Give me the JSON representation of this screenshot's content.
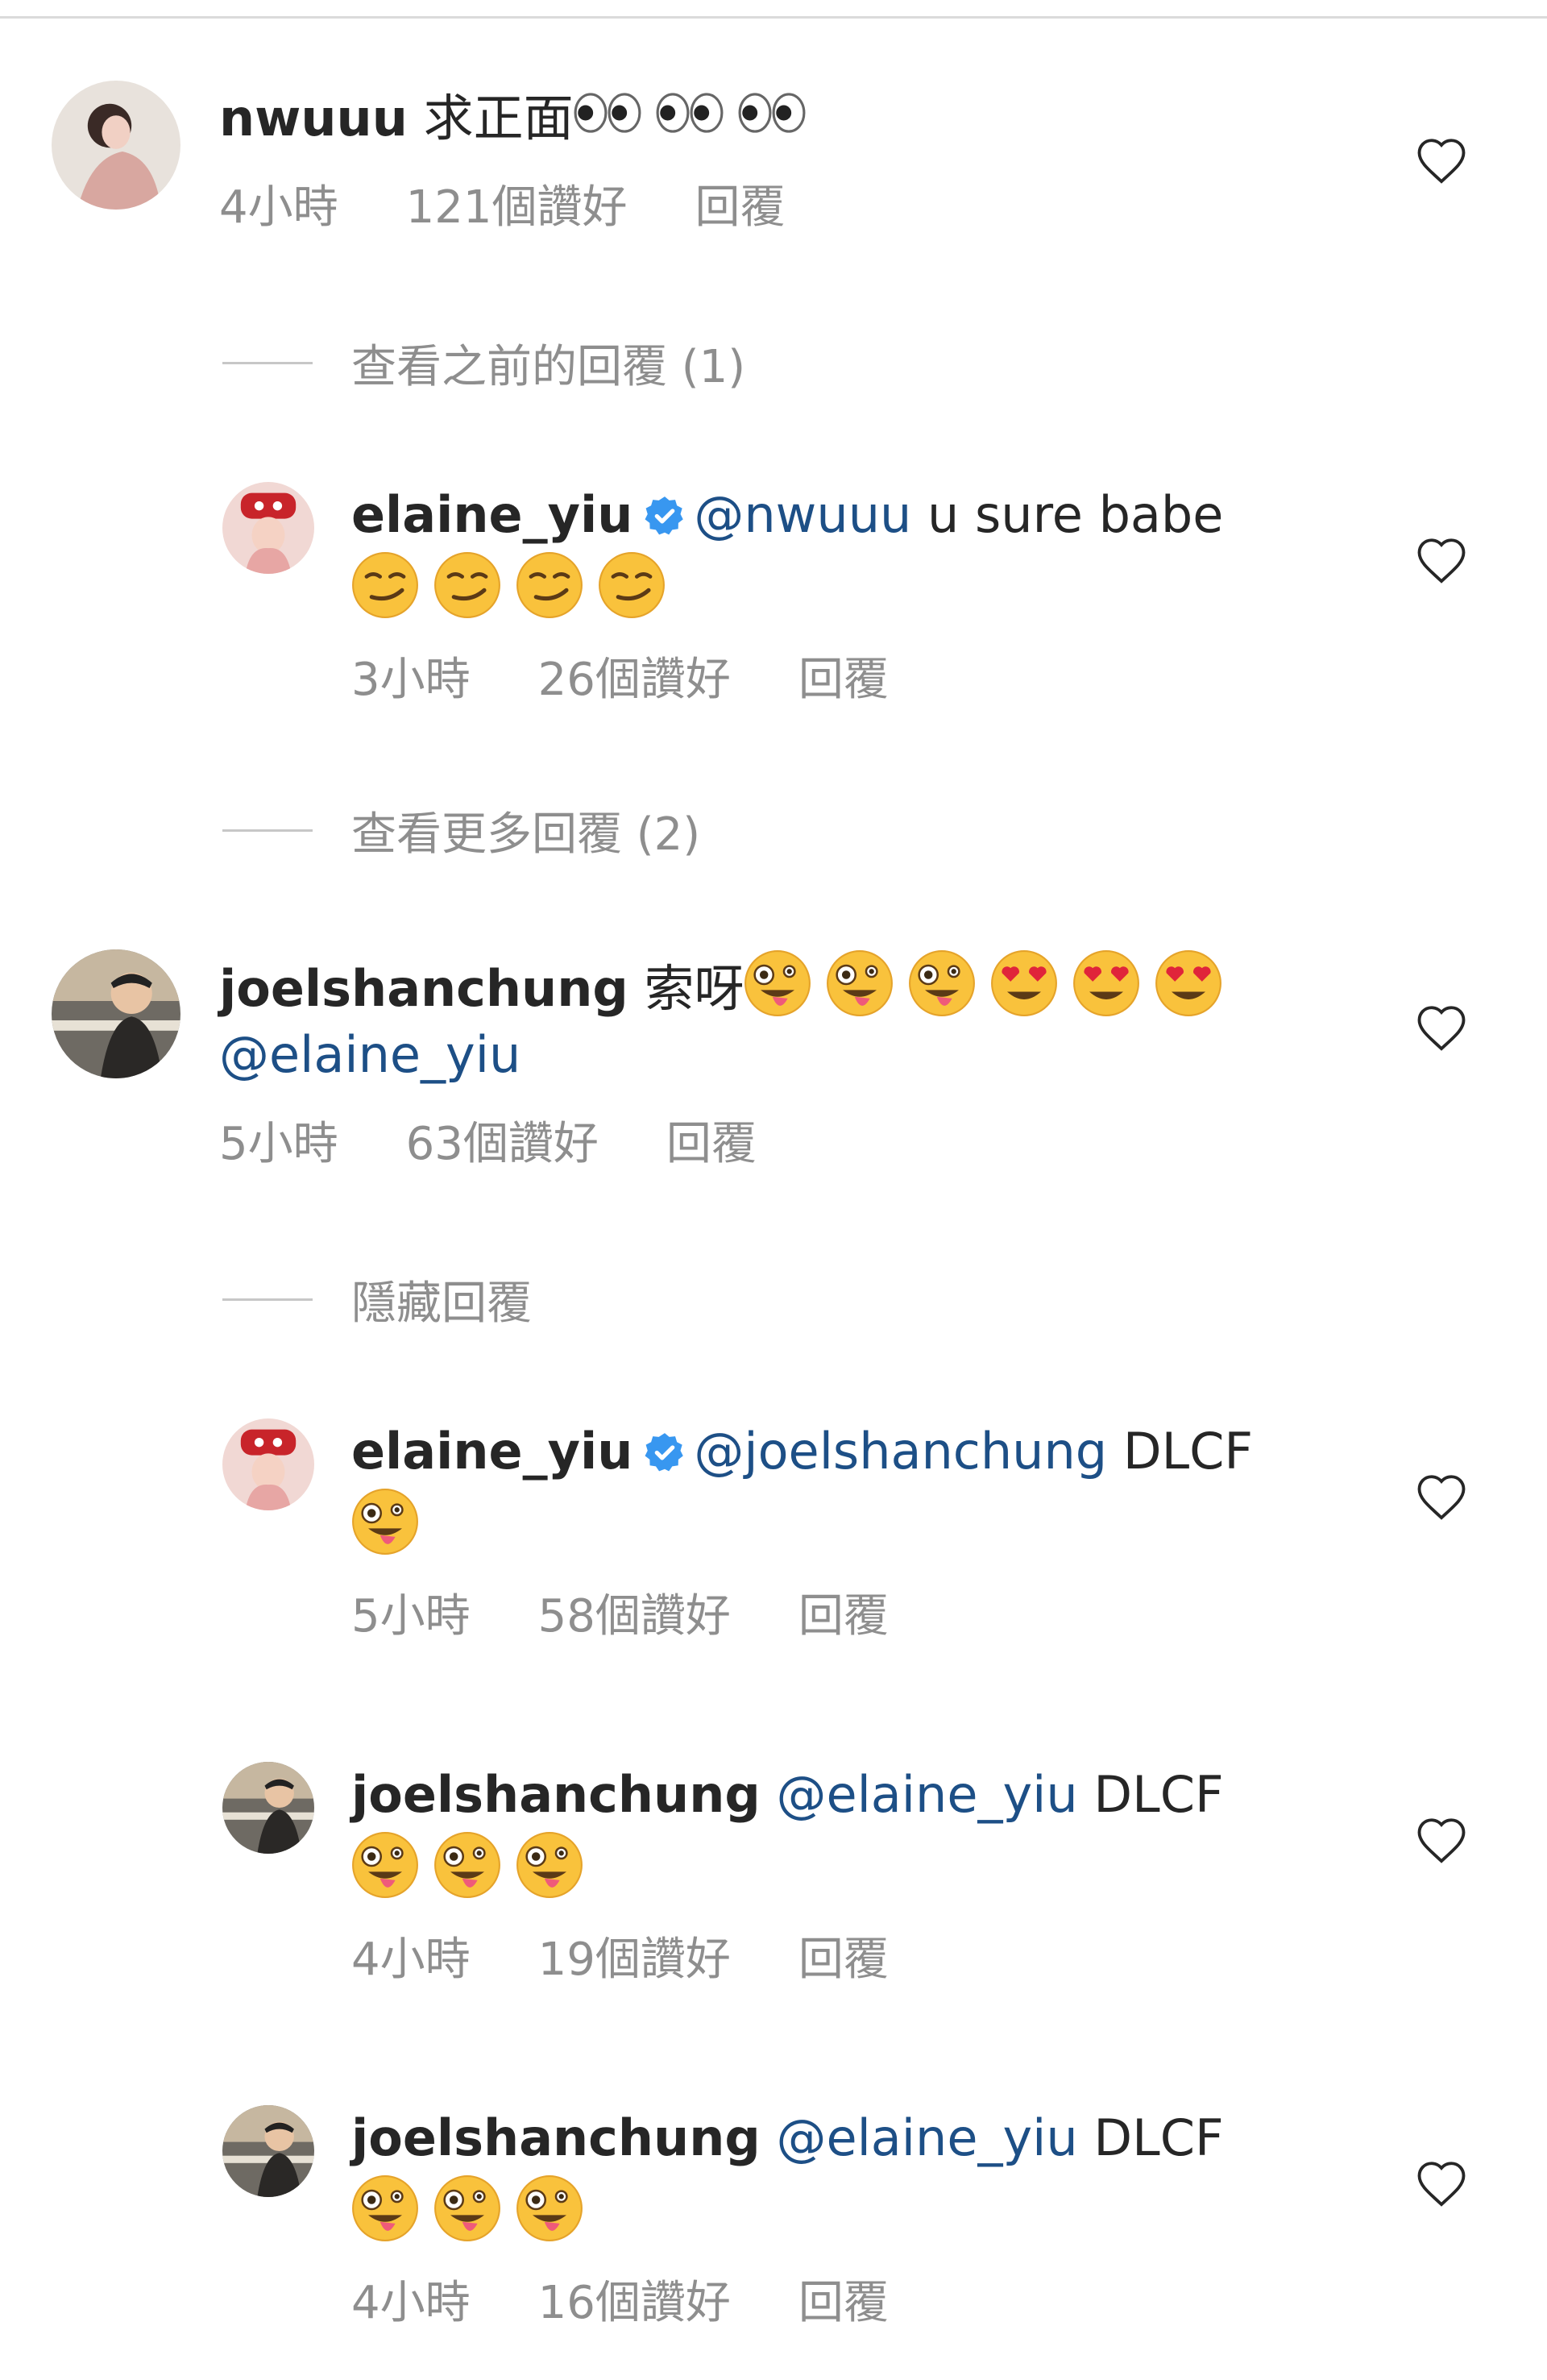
{
  "comments": [
    {
      "username": "nwuuu",
      "verified": false,
      "mention": "",
      "text": "求正面",
      "text2": "",
      "emojis": [
        "eyes",
        "eyes",
        "eyes"
      ],
      "time": "4小時",
      "likes": "121個讚好",
      "reply": "回覆"
    },
    {
      "username": "elaine_yiu",
      "verified": true,
      "mention": "@nwuuu",
      "text": "u sure babe",
      "text2": "",
      "emojis": [
        "smirk",
        "smirk",
        "smirk",
        "smirk"
      ],
      "time": "3小時",
      "likes": "26個讚好",
      "reply": "回覆"
    },
    {
      "username": "joelshanchung",
      "verified": false,
      "mention": "",
      "text": "索呀",
      "text2": "@elaine_yiu",
      "emojis": [
        "zany",
        "zany",
        "zany",
        "heart-eyes",
        "heart-eyes",
        "heart-eyes"
      ],
      "time": "5小時",
      "likes": "63個讚好",
      "reply": "回覆"
    },
    {
      "username": "elaine_yiu",
      "verified": true,
      "mention": "@joelshanchung",
      "text": "DLCF",
      "text2": "",
      "emojis": [
        "zany"
      ],
      "time": "5小時",
      "likes": "58個讚好",
      "reply": "回覆"
    },
    {
      "username": "joelshanchung",
      "verified": false,
      "mention": "@elaine_yiu",
      "text": "DLCF",
      "text2": "",
      "emojis": [
        "zany",
        "zany",
        "zany"
      ],
      "time": "4小時",
      "likes": "19個讚好",
      "reply": "回覆"
    },
    {
      "username": "joelshanchung",
      "verified": false,
      "mention": "@elaine_yiu",
      "text": "DLCF",
      "text2": "",
      "emojis": [
        "zany",
        "zany",
        "zany"
      ],
      "time": "4小時",
      "likes": "16個讚好",
      "reply": "回覆"
    }
  ],
  "toggles": {
    "view_previous": "查看之前的回覆 (1)",
    "view_more": "查看更多回覆 (2)",
    "hide": "隱藏回覆"
  },
  "colors": {
    "username": "#262626",
    "mention": "#1d4f86",
    "meta": "#8e8e8e",
    "verified": "#3897f0",
    "divider": "#dbdbdb"
  }
}
